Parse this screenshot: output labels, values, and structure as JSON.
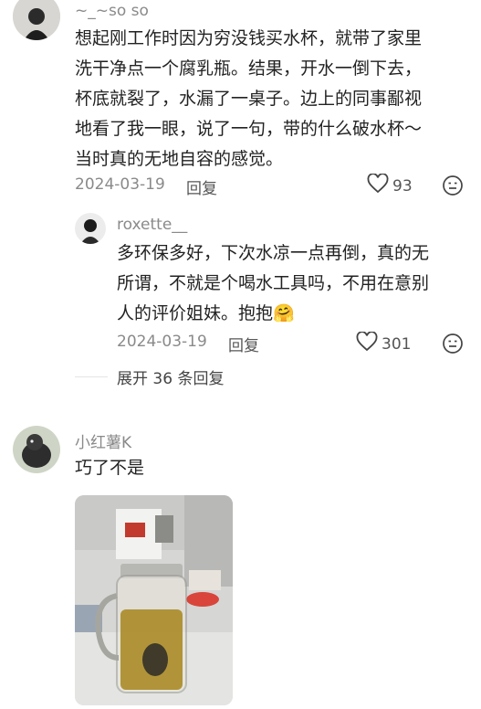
{
  "comment1": {
    "username": "~_~so so",
    "text_lines": [
      "想起刚工作时因为穷没钱买水杯，就带了家里",
      "洗干净点一个腐乳瓶。结果，开水一倒下去，",
      "杯底就裂了，水漏了一桌子。边上的同事鄙视",
      "地看了我一眼，说了一句，带的什么破水杯～",
      "当时真的无地自容的感觉。"
    ],
    "date": "2024-03-19",
    "reply_label": "回复",
    "likes": "93",
    "icons": {
      "like": "heart-icon",
      "emoji": "emoji-face-icon"
    }
  },
  "reply1": {
    "username": "roxette__",
    "text_lines": [
      "多环保多好，下次水凉一点再倒，真的无",
      "所谓，不就是个喝水工具吗，不用在意别",
      "人的评价姐妹。抱抱"
    ],
    "emoji": "🤗",
    "date": "2024-03-19",
    "reply_label": "回复",
    "likes": "301"
  },
  "expand_replies": "展开 36 条回复",
  "comment2": {
    "username": "小红薯K",
    "text": "巧了不是",
    "image": "glass-jar-photo"
  }
}
